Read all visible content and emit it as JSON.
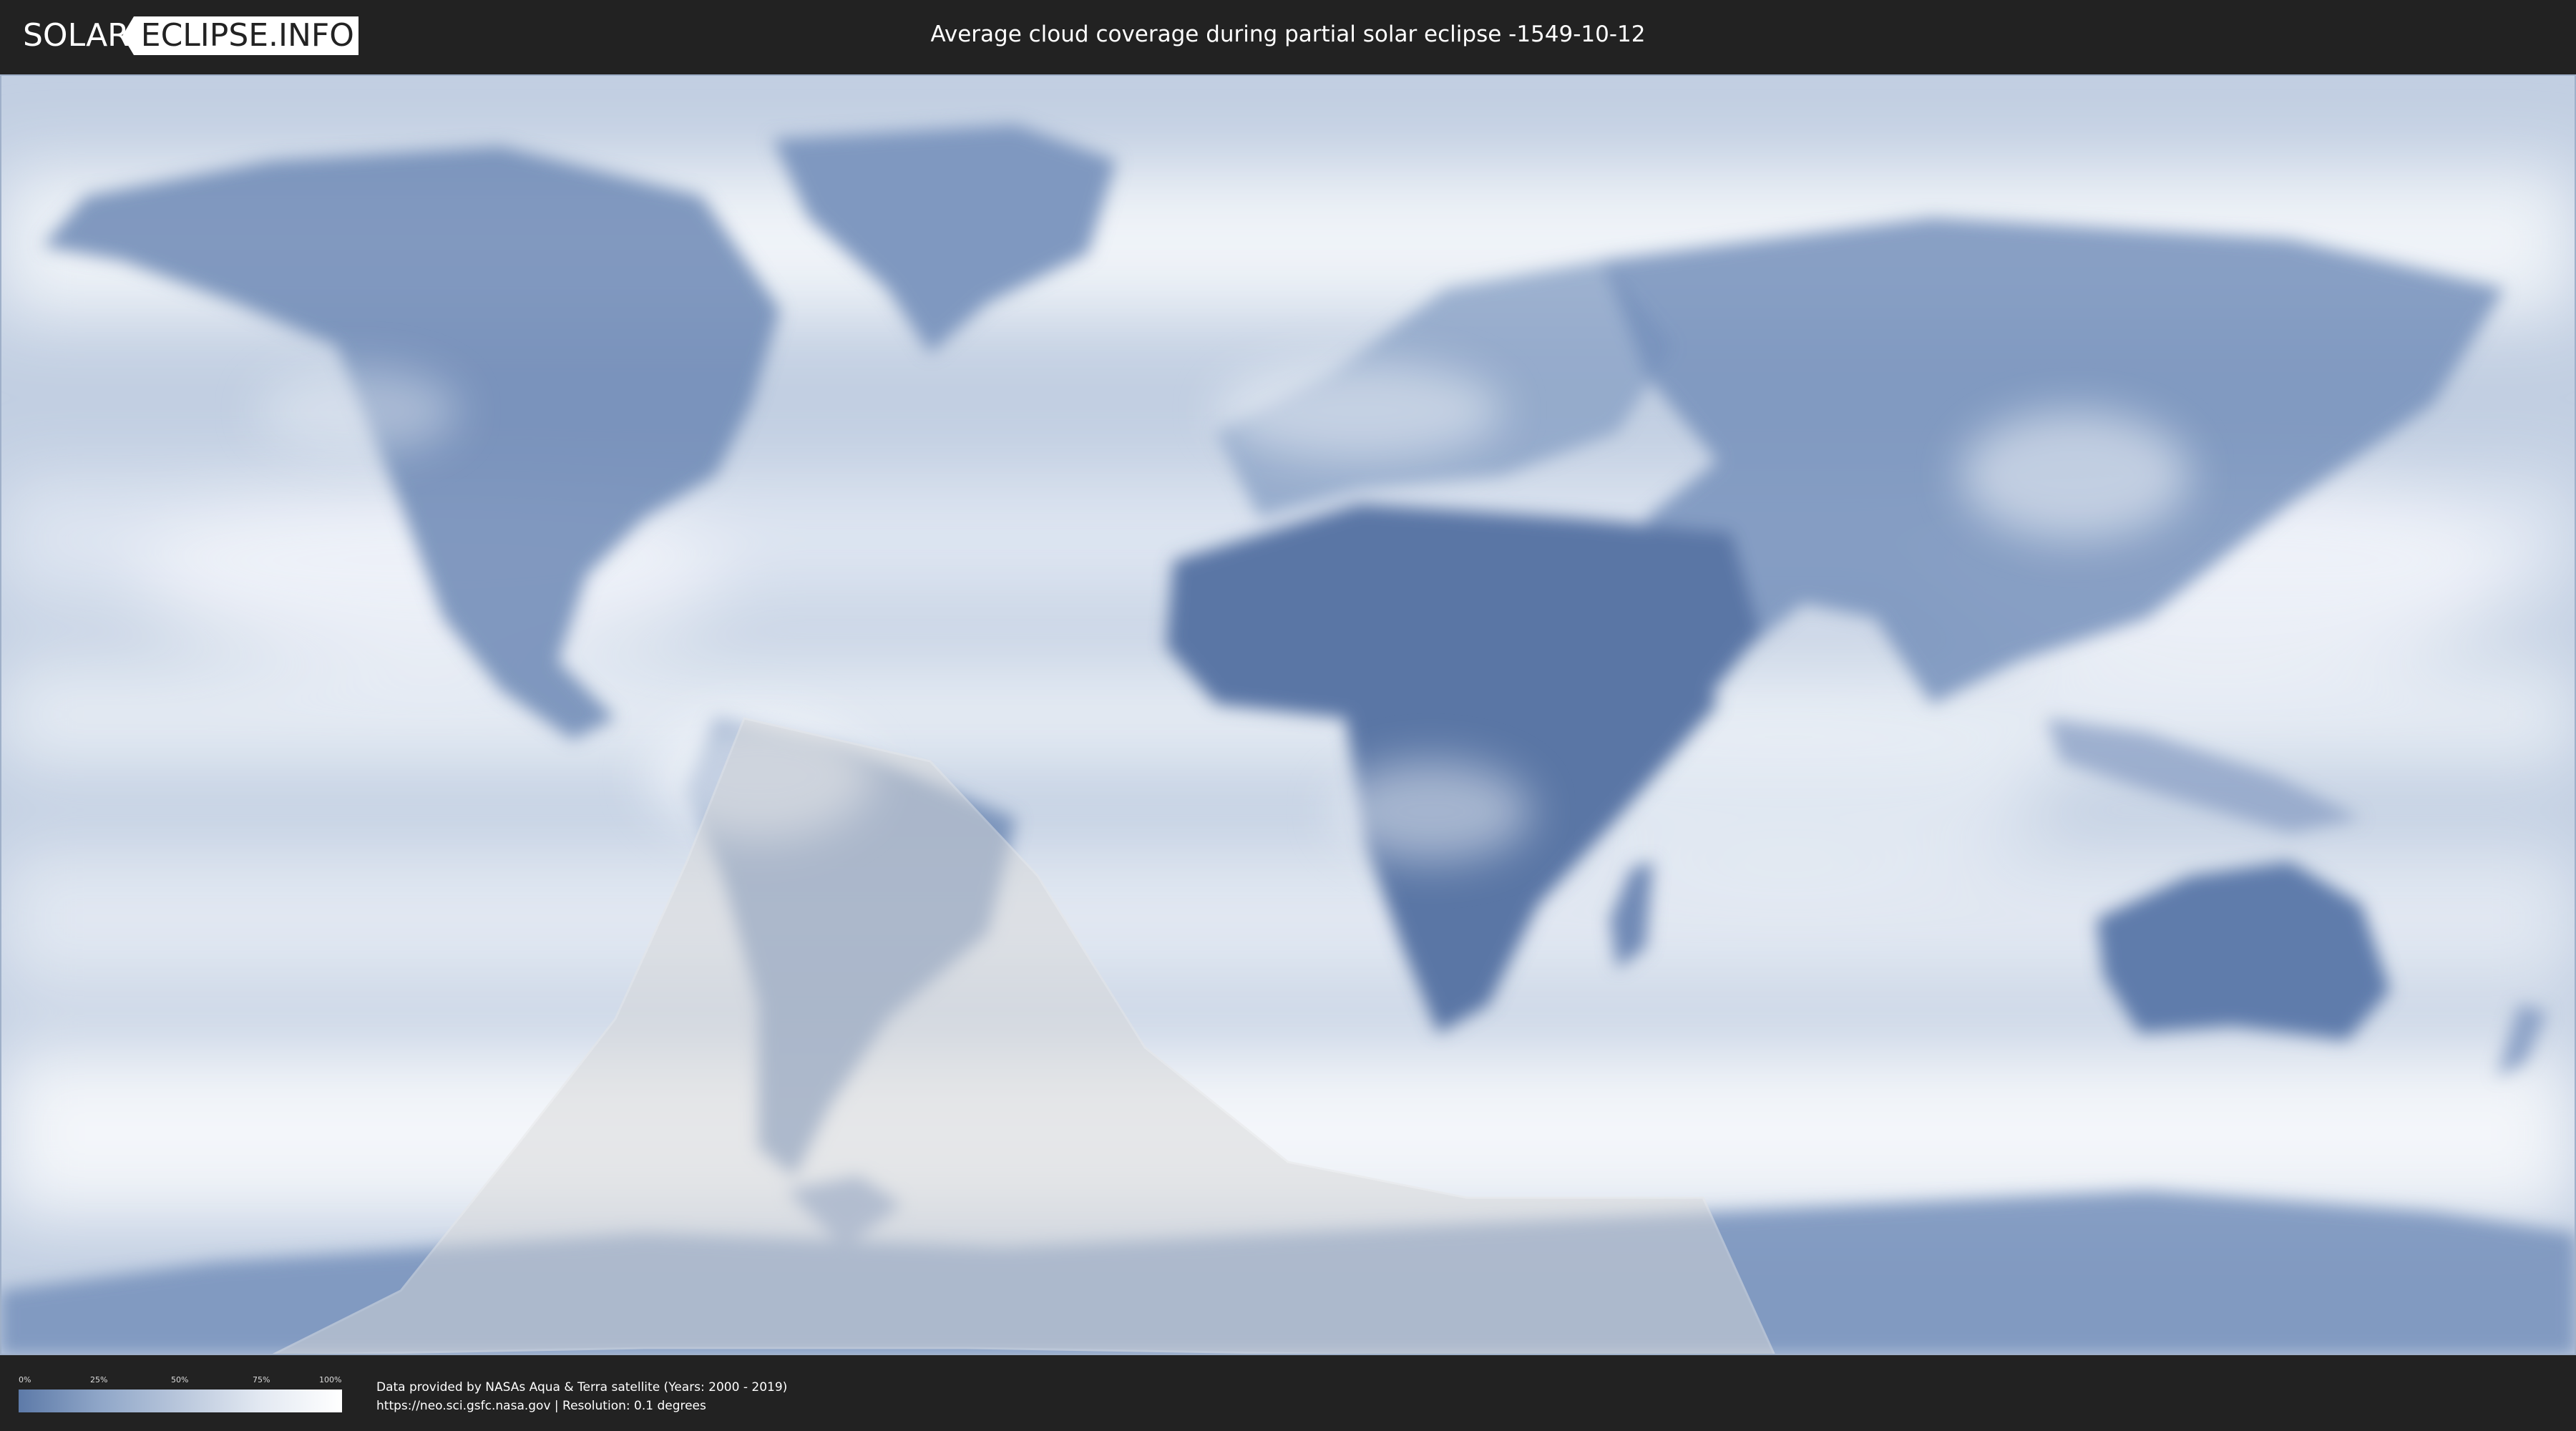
{
  "header": {
    "logo_left": "SOLAR",
    "logo_right": "ECLIPSE.INFO",
    "title": "Average cloud coverage during partial solar eclipse -1549-10-12"
  },
  "map": {
    "layer": "average cloud coverage",
    "land_color": "#5a76a5",
    "cloud_color": "#ffffff",
    "eclipse_overlay_color": "#d9d9d9",
    "eclipse_type": "partial"
  },
  "legend": {
    "ticks": [
      "0%",
      "25%",
      "50%",
      "75%",
      "100%"
    ],
    "gradient_start": "#5d7aa8",
    "gradient_end": "#ffffff"
  },
  "footer": {
    "credit_line1": "Data provided by NASAs Aqua & Terra satellite (Years: 2000 - 2019)",
    "credit_line2": "https://neo.sci.gsfc.nasa.gov | Resolution: 0.1 degrees"
  }
}
